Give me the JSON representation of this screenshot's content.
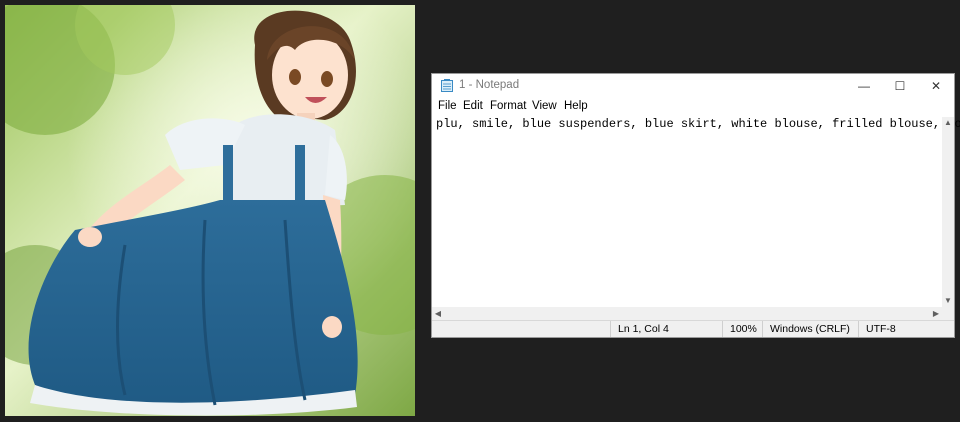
{
  "window": {
    "title": "1 - Notepad",
    "minimize_glyph": "—",
    "maximize_glyph": "☐",
    "close_glyph": "✕"
  },
  "menu": [
    "File",
    "Edit",
    "Format",
    "View",
    "Help"
  ],
  "editor": {
    "text": "plu, smile, blue suspenders, blue skirt, white blouse, frilled blouse, forest"
  },
  "status": {
    "position": "Ln 1, Col 4",
    "zoom": "100%",
    "line_ending": "Windows (CRLF)",
    "encoding": "UTF-8"
  },
  "icons": {
    "app": "notepad-icon",
    "scroll_up": "▲",
    "scroll_down": "▼",
    "scroll_left": "◀",
    "scroll_right": "▶"
  },
  "colors": {
    "desktop": "#1f1f1f",
    "dress": "#2f6f9c",
    "foliage": "#8fb84a"
  }
}
